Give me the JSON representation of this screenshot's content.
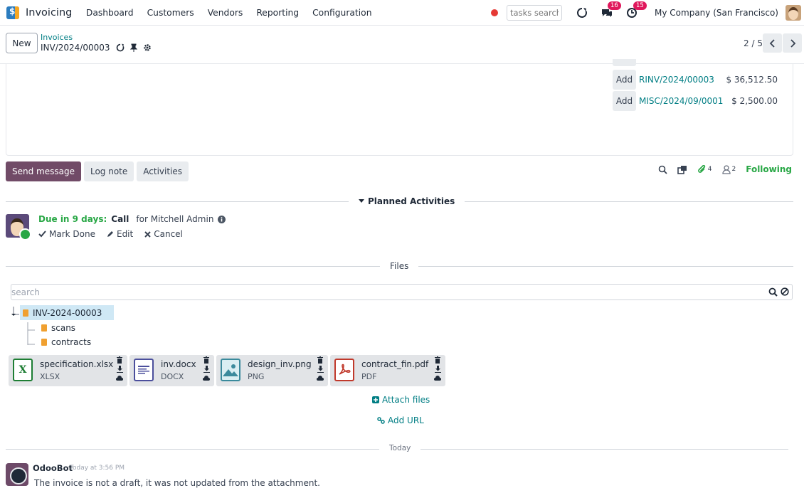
{
  "navbar": {
    "app_name": "Invoicing",
    "menu": [
      "Dashboard",
      "Customers",
      "Vendors",
      "Reporting",
      "Configuration"
    ],
    "search_placeholder": "tasks search",
    "messages_count": "16",
    "activities_count": "15",
    "company": "My Company (San Francisco)"
  },
  "control": {
    "new_label": "New",
    "breadcrumb": "Invoices",
    "record": "INV/2024/00003",
    "pager": "2 / 5"
  },
  "credits": [
    {
      "add": "Add",
      "ref": "RINV/2024/00003",
      "amount": "$ 36,512.50"
    },
    {
      "add": "Add",
      "ref": "MISC/2024/09/0001",
      "amount": "$ 2,500.00"
    }
  ],
  "chatter": {
    "send_message": "Send message",
    "log_note": "Log note",
    "activities": "Activities",
    "attachments_count": "4",
    "followers_count": "2",
    "following": "Following"
  },
  "planned": {
    "header": "Planned Activities",
    "due": "Due in 9 days:",
    "type": "Call",
    "for": "for Mitchell Admin",
    "mark_done": "Mark Done",
    "edit": "Edit",
    "cancel": "Cancel"
  },
  "files": {
    "header": "Files",
    "search_placeholder": "search",
    "root_folder": "INV-2024-00003",
    "subfolders": [
      "scans",
      "contracts"
    ],
    "items": [
      {
        "name": "specification.xlsx",
        "type": "XLSX",
        "icon": "excel-icon",
        "color": "#1e7e34"
      },
      {
        "name": "inv.docx",
        "type": "DOCX",
        "icon": "document-icon",
        "color": "#4b4f9c"
      },
      {
        "name": "design_inv.png",
        "type": "PNG",
        "icon": "image-icon",
        "color": "#3a8a9c"
      },
      {
        "name": "contract_fin.pdf",
        "type": "PDF",
        "icon": "pdf-icon",
        "color": "#c0392b"
      }
    ],
    "attach_files": "Attach files",
    "add_url": "Add URL"
  },
  "messages": {
    "separator": "Today",
    "author": "OdooBot",
    "time": "Today at 3:56 PM",
    "body": "The invoice is not a draft, it was not updated from the attachment."
  },
  "colors": {
    "brand": "#714b67",
    "link": "#017e84",
    "success": "#28a745",
    "badge": "#e0185c"
  }
}
